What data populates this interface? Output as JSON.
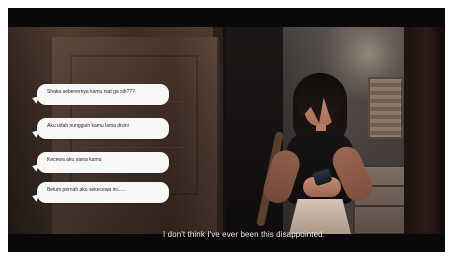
{
  "chat": {
    "messages": [
      {
        "text": "Shaka sebenernya kamu niat ga sih???"
      },
      {
        "text": "Aku udah nungguin kamu lama disini"
      },
      {
        "text": "Kecewa aku sama kamu"
      },
      {
        "text": "Belum pernah aku sekecewa ini......"
      }
    ]
  },
  "subtitle": {
    "text": "I don't think I've ever been this disappointed."
  }
}
